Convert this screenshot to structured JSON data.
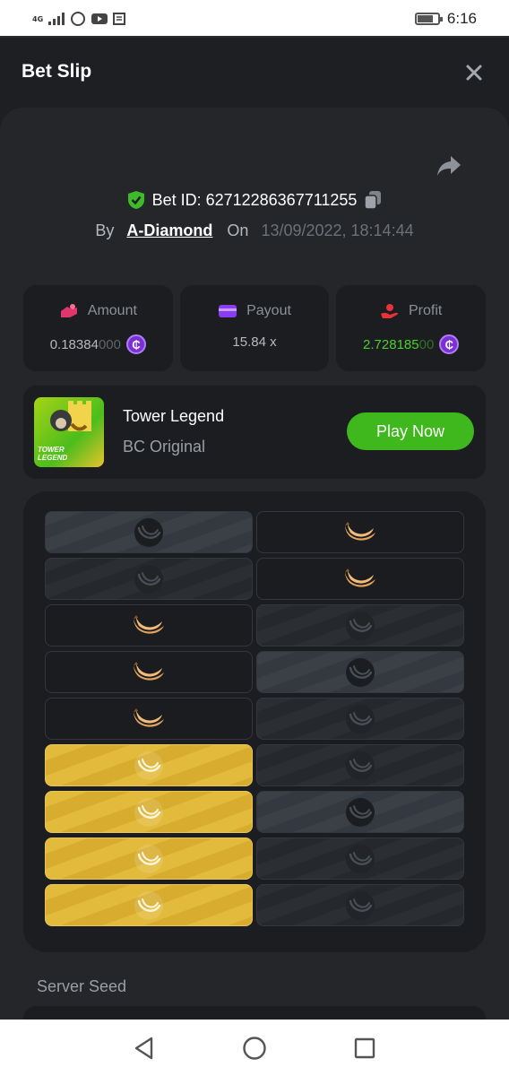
{
  "status_bar": {
    "network": "4G",
    "time": "6:16",
    "battery_level": 0.75
  },
  "header": {
    "title": "Bet Slip"
  },
  "bet": {
    "id_text": "Bet ID: 62712286367711255",
    "by_label": "By",
    "username": "A-Diamond",
    "on_label": "On",
    "datetime": "13/09/2022, 18:14:44"
  },
  "stats": {
    "amount": {
      "label": "Amount",
      "value_main": "0.18384",
      "value_trail": "000"
    },
    "payout": {
      "label": "Payout",
      "value": "15.84 x"
    },
    "profit": {
      "label": "Profit",
      "value_main": "2.728185",
      "value_trail": "00"
    },
    "currency_symbol": "₵"
  },
  "game": {
    "name": "Tower Legend",
    "subtitle": "BC Original",
    "thumb_text_line1": "TOWER",
    "thumb_text_line2": "LEGEND",
    "play_label": "Play Now"
  },
  "board": {
    "rows": [
      [
        "highlight",
        "banana"
      ],
      [
        "revealed",
        "banana"
      ],
      [
        "banana",
        "revealed"
      ],
      [
        "banana",
        "highlight"
      ],
      [
        "banana",
        "revealed"
      ],
      [
        "win",
        "revealed"
      ],
      [
        "win",
        "highlight"
      ],
      [
        "win",
        "revealed"
      ],
      [
        "win",
        "revealed"
      ]
    ]
  },
  "seed": {
    "label": "Server Seed"
  },
  "colors": {
    "accent_green": "#3eb81d",
    "profit_green": "#4cd02b",
    "coin_purple": "#7b2fd6",
    "win_gold": "#e3bb3c",
    "amount_icon": "#e0366b",
    "payout_icon": "#8a3df0",
    "profit_icon": "#e8323a"
  },
  "icons": {
    "close": "close-icon",
    "share": "share-icon",
    "verified": "shield-check-icon",
    "copy": "copy-icon",
    "amount": "bet-amount-icon",
    "payout": "wallet-icon",
    "profit": "hand-coin-icon",
    "banana": "banana-icon",
    "empty": "banana-outline-icon"
  }
}
